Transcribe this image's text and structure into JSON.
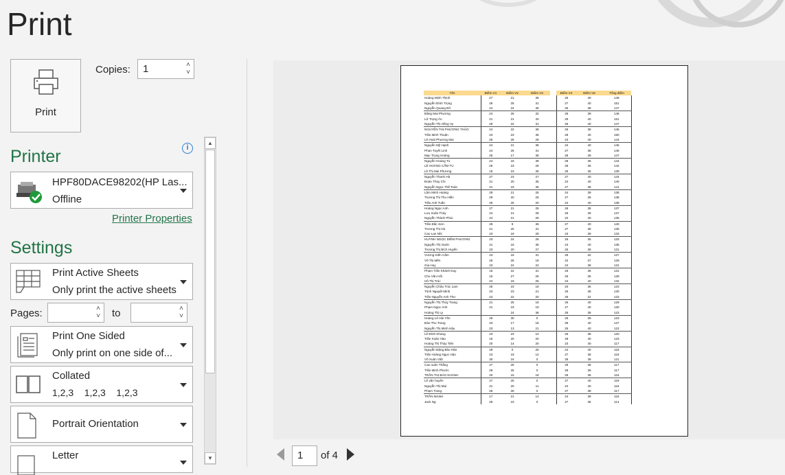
{
  "title": "Print",
  "print_button": {
    "label": "Print"
  },
  "copies": {
    "label": "Copies:",
    "value": "1"
  },
  "printer": {
    "heading": "Printer",
    "name": "HPF80DACE98202(HP Las...",
    "status": "Offline",
    "properties_link": "Printer Properties"
  },
  "settings": {
    "heading": "Settings",
    "what": {
      "title": "Print Active Sheets",
      "subtitle": "Only print the active sheets"
    },
    "pages": {
      "label": "Pages:",
      "to_label": "to",
      "from_value": "",
      "to_value": ""
    },
    "sides": {
      "title": "Print One Sided",
      "subtitle": "Only print on one side of..."
    },
    "collate": {
      "title": "Collated",
      "subtitle": "1,2,3    1,2,3    1,2,3"
    },
    "orientation": {
      "title": "Portrait Orientation"
    },
    "paper": {
      "title": "Letter"
    }
  },
  "pager": {
    "current": "1",
    "of_label": "of 4"
  },
  "sheet": {
    "headers": [
      "Tên",
      "Điểm V1",
      "Điểm V2",
      "Điểm V3",
      "Điểm V4",
      "Điểm V5",
      "Tổng điểm"
    ],
    "rows": [
      [
        "Hoàng Minh Thịnh",
        "27",
        "21",
        "36",
        "25",
        "40",
        "149"
      ],
      [
        "Nguyễn Đình Trọng",
        "28",
        "25",
        "31",
        "27",
        "40",
        "151"
      ],
      [
        "Nguyễn Quang Đô",
        "24",
        "24",
        "36",
        "25",
        "38",
        "147"
      ],
      [
        "Đặng Mai Phương",
        "24",
        "26",
        "32",
        "25",
        "39",
        "146"
      ],
      [
        "Lữ Trọng Ân",
        "21",
        "21",
        "40",
        "29",
        "40",
        "151"
      ],
      [
        "Nguyễn Thị Hồng Vy",
        "29",
        "22",
        "31",
        "25",
        "40",
        "147"
      ],
      [
        "NGUYỄN THỊ PHƯƠNG THẢO",
        "24",
        "22",
        "36",
        "26",
        "38",
        "146"
      ],
      [
        "Trần Minh Thuận",
        "23",
        "23",
        "36",
        "28",
        "40",
        "150"
      ],
      [
        "Lê Hoài Phương Mai",
        "26",
        "26",
        "29",
        "23",
        "40",
        "144"
      ],
      [
        "Nguyễn Mỹ Hạnh",
        "24",
        "21",
        "36",
        "24",
        "40",
        "145"
      ],
      [
        "Phan Tuyết Linh",
        "24",
        "26",
        "31",
        "27",
        "38",
        "146"
      ],
      [
        "Mạc Trọng Hoàng",
        "25",
        "17",
        "38",
        "28",
        "39",
        "147"
      ],
      [
        "Nguyễn Hoàng Tú",
        "24",
        "18",
        "38",
        "28",
        "36",
        "144"
      ],
      [
        "LÊ HOÀNG CẨM TÚ",
        "26",
        "23",
        "29",
        "28",
        "36",
        "142"
      ],
      [
        "Lê Thị Mai Phương",
        "18",
        "23",
        "36",
        "26",
        "36",
        "139"
      ],
      [
        "Nguyễn Thanh Hà",
        "27",
        "23",
        "27",
        "27",
        "40",
        "144"
      ],
      [
        "Đoàn Thùy Chi",
        "21",
        "20",
        "35",
        "24",
        "40",
        "140"
      ],
      [
        "Nguyễn Ngọc Thế Toàn",
        "21",
        "19",
        "36",
        "27",
        "38",
        "141"
      ],
      [
        "Lâm Minh Hoàng",
        "29",
        "21",
        "25",
        "24",
        "39",
        "138"
      ],
      [
        "Trương Thị Thu Hiền",
        "29",
        "20",
        "26",
        "27",
        "36",
        "138"
      ],
      [
        "Trần Anh Tuấn",
        "29",
        "25",
        "20",
        "24",
        "40",
        "138"
      ],
      [
        "Hoàng Ngọc Anh",
        "27",
        "21",
        "25",
        "26",
        "38",
        "137"
      ],
      [
        "Lưu Xuân Thủy",
        "24",
        "21",
        "28",
        "25",
        "39",
        "137"
      ],
      [
        "Nguyễn Thành Phúc",
        "24",
        "21",
        "28",
        "22",
        "40",
        "135"
      ],
      [
        "Trần Đắc Sơn",
        "28",
        "9",
        "36",
        "27",
        "40",
        "140"
      ],
      [
        "Trương Thị Hà",
        "21",
        "20",
        "31",
        "27",
        "36",
        "135"
      ],
      [
        "Cao Lan Nhi",
        "23",
        "19",
        "29",
        "23",
        "39",
        "133"
      ],
      [
        "HUỲNH NGỌC DIỄM PHƯƠNG",
        "23",
        "24",
        "26",
        "25",
        "35",
        "133"
      ],
      [
        "Nguyễn Thị Oanh",
        "21",
        "16",
        "36",
        "24",
        "40",
        "135"
      ],
      [
        "Trương Thị Bích Huyền",
        "23",
        "20",
        "27",
        "25",
        "36",
        "131"
      ],
      [
        "Vương Kiến Cầm",
        "23",
        "16",
        "31",
        "25",
        "32",
        "127"
      ],
      [
        "Võ Thị Mến",
        "25",
        "26",
        "19",
        "22",
        "37",
        "129"
      ],
      [
        "Gia Huy",
        "23",
        "24",
        "22",
        "24",
        "38",
        "131"
      ],
      [
        "Phạm Trần Khánh Duy",
        "16",
        "22",
        "31",
        "26",
        "36",
        "131"
      ],
      [
        "Chu Văn Hối",
        "15",
        "27",
        "26",
        "25",
        "35",
        "128"
      ],
      [
        "Hồ Thị Trúc",
        "24",
        "19",
        "25",
        "24",
        "40",
        "132"
      ],
      [
        "Nguyễn Châu Trúc Lam",
        "25",
        "23",
        "19",
        "20",
        "36",
        "123"
      ],
      [
        "Trịnh Nguyệt Minh",
        "23",
        "23",
        "21",
        "25",
        "38",
        "130"
      ],
      [
        "Trần Nguyễn Anh Thư",
        "24",
        "22",
        "20",
        "26",
        "31",
        "123"
      ],
      [
        "Nguyễn Thị Thùy Trang",
        "21",
        "25",
        "18",
        "25",
        "40",
        "129"
      ],
      [
        "Phạm Ngọc Ánh",
        "21",
        "23",
        "19",
        "27",
        "40",
        "130"
      ],
      [
        "Hoàng Thị Ly",
        "",
        "24",
        "36",
        "25",
        "38",
        "123"
      ],
      [
        "Hoàng Lê Hải Yến",
        "29",
        "30",
        "0",
        "25",
        "39",
        "123"
      ],
      [
        "Đào Thu Trang",
        "23",
        "17",
        "18",
        "29",
        "40",
        "127"
      ],
      [
        "Nguyễn Thị Minh Hậu",
        "23",
        "13",
        "21",
        "25",
        "40",
        "122"
      ],
      [
        "Lê Đình Khang",
        "23",
        "23",
        "10",
        "26",
        "38",
        "120"
      ],
      [
        "Trần Xuân Hào",
        "15",
        "20",
        "20",
        "28",
        "40",
        "123"
      ],
      [
        "Hoàng Thị Thủy Tiên",
        "20",
        "14",
        "20",
        "23",
        "40",
        "117"
      ],
      [
        "Nguyễn Đặng Bảo Hân",
        "29",
        "0",
        "25",
        "24",
        "40",
        "118"
      ],
      [
        "Trần Hoàng Ngọc Hảo",
        "23",
        "19",
        "12",
        "27",
        "38",
        "119"
      ],
      [
        "Võ Xuân Việt",
        "30",
        "24",
        "0",
        "28",
        "39",
        "121"
      ],
      [
        "Cao xuân Thắng",
        "27",
        "26",
        "0",
        "28",
        "36",
        "117"
      ],
      [
        "Trần Minh Phước",
        "28",
        "25",
        "0",
        "28",
        "36",
        "117"
      ],
      [
        "TRẦN THỊ BẢO KHÁNH",
        "20",
        "15",
        "18",
        "26",
        "36",
        "115"
      ],
      [
        "Lê văn huyên",
        "27",
        "25",
        "0",
        "27",
        "40",
        "119"
      ],
      [
        "Nguyễn Thị Mai",
        "21",
        "20",
        "11",
        "24",
        "40",
        "116"
      ],
      [
        "Phạm Trang",
        "26",
        "26",
        "0",
        "27",
        "38",
        "117"
      ],
      [
        "TRẦN MẠNH",
        "17",
        "21",
        "14",
        "24",
        "39",
        "115"
      ],
      [
        "Jack Ng",
        "28",
        "23",
        "0",
        "27",
        "36",
        "114"
      ]
    ]
  }
}
